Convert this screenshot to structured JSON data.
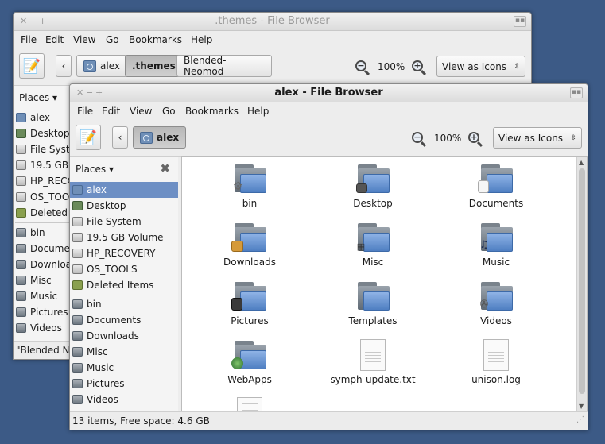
{
  "menu": [
    "File",
    "Edit",
    "View",
    "Go",
    "Bookmarks",
    "Help"
  ],
  "back_window": {
    "title": ".themes - File Browser",
    "crumbs": [
      "alex",
      ".themes",
      "Blended-Neomod"
    ],
    "zoom": "100%",
    "view_mode": "View as Icons",
    "places_label": "Places",
    "sidebar_items": [
      "alex",
      "Desktop",
      "File System",
      "19.5 GB",
      "HP_RECO",
      "OS_TOO",
      "Deleted"
    ],
    "sidebar_folders": [
      "bin",
      "Documen",
      "Downloa",
      "Misc",
      "Music",
      "Pictures",
      "Videos"
    ],
    "status": "\"Blended Ne"
  },
  "front_window": {
    "title": "alex - File Browser",
    "crumbs": [
      "alex"
    ],
    "zoom": "100%",
    "view_mode": "View as Icons",
    "places_label": "Places",
    "sidebar_items": [
      "alex",
      "Desktop",
      "File System",
      "19.5 GB Volume",
      "HP_RECOVERY",
      "OS_TOOLS",
      "Deleted Items"
    ],
    "sidebar_folders": [
      "bin",
      "Documents",
      "Downloads",
      "Misc",
      "Music",
      "Pictures",
      "Videos"
    ],
    "files": [
      {
        "name": "bin",
        "kind": "folder",
        "emblem": "gear-icon"
      },
      {
        "name": "Desktop",
        "kind": "folder",
        "emblem": "desktop-icon"
      },
      {
        "name": "Documents",
        "kind": "folder",
        "emblem": "document-icon"
      },
      {
        "name": "Downloads",
        "kind": "folder",
        "emblem": "download-icon"
      },
      {
        "name": "Misc",
        "kind": "folder",
        "emblem": "misc-icon"
      },
      {
        "name": "Music",
        "kind": "folder",
        "emblem": "music-icon"
      },
      {
        "name": "Pictures",
        "kind": "folder",
        "emblem": "camera-icon"
      },
      {
        "name": "Templates",
        "kind": "folder",
        "emblem": ""
      },
      {
        "name": "Videos",
        "kind": "folder",
        "emblem": "film-icon"
      },
      {
        "name": "WebApps",
        "kind": "folder",
        "emblem": "globe-icon"
      },
      {
        "name": "symph-update.txt",
        "kind": "text-file",
        "emblem": ""
      },
      {
        "name": "unison.log",
        "kind": "text-file",
        "emblem": ""
      },
      {
        "name": "",
        "kind": "text-file",
        "emblem": ""
      }
    ],
    "status": "13 items, Free space: 4.6 GB"
  },
  "colors": {
    "selection": "#6d8fc4",
    "desktop": "#3c5a86"
  }
}
